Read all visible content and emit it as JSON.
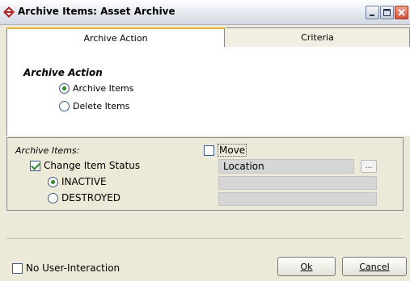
{
  "window": {
    "title": "Archive Items:  Asset Archive"
  },
  "tabs": [
    {
      "label": "Archive Action",
      "active": true
    },
    {
      "label": "Criteria",
      "active": false
    }
  ],
  "archive_action": {
    "heading": "Archive Action",
    "options": [
      {
        "label": "Archive Items",
        "selected": true
      },
      {
        "label": "Delete Items",
        "selected": false
      }
    ]
  },
  "archive_items": {
    "label": "Archive Items:",
    "move": {
      "label": "Move",
      "checked": false
    },
    "change_status": {
      "label": "Change Item Status",
      "checked": true
    },
    "status_options": [
      {
        "label": "INACTIVE",
        "selected": true
      },
      {
        "label": "DESTROYED",
        "selected": false
      }
    ],
    "location_field": "Location",
    "browse_button": "..."
  },
  "footer": {
    "no_interaction": {
      "label": "No User-Interaction",
      "checked": false
    },
    "ok_label": "Ok",
    "cancel_label": "Cancel"
  },
  "colors": {
    "accent_tab": "#f2b33d",
    "check_green": "#268c2a",
    "panel_bg": "#ece9d8"
  }
}
